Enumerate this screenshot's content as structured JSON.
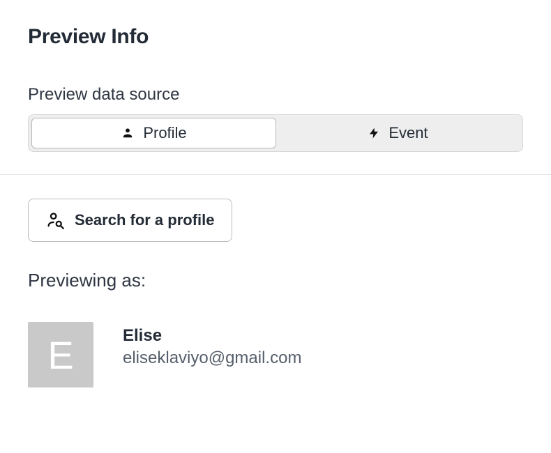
{
  "heading": "Preview Info",
  "data_source": {
    "label": "Preview data source",
    "options": [
      {
        "label": "Profile",
        "active": true
      },
      {
        "label": "Event",
        "active": false
      }
    ]
  },
  "search_button_label": "Search for a profile",
  "previewing_label": "Previewing as:",
  "profile": {
    "initial": "E",
    "name": "Elise",
    "email": "eliseklaviyo@gmail.com"
  }
}
